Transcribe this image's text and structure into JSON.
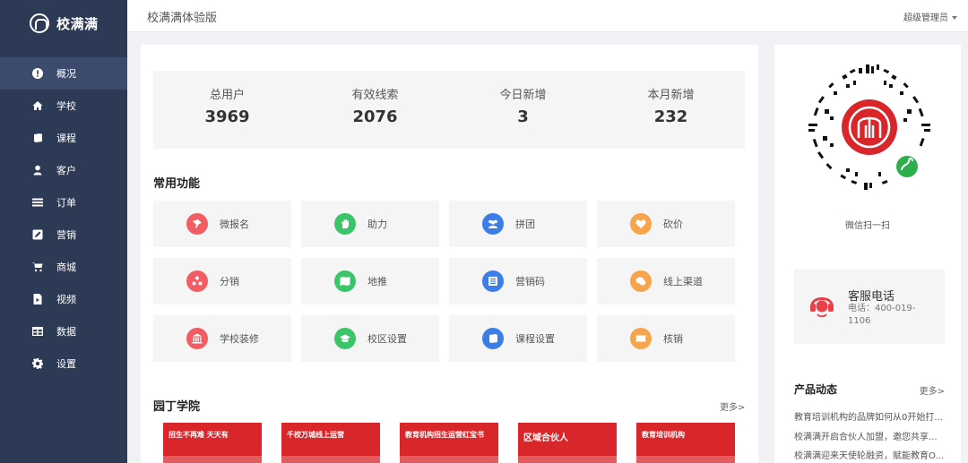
{
  "brand": {
    "name": "校满满"
  },
  "sidebar": {
    "items": [
      {
        "label": "概况",
        "icon": "alert-circle-icon",
        "active": true
      },
      {
        "label": "学校",
        "icon": "home-icon"
      },
      {
        "label": "课程",
        "icon": "book-icon"
      },
      {
        "label": "客户",
        "icon": "user-icon"
      },
      {
        "label": "订单",
        "icon": "list-icon"
      },
      {
        "label": "营销",
        "icon": "edit-icon"
      },
      {
        "label": "商城",
        "icon": "cart-icon"
      },
      {
        "label": "视频",
        "icon": "video-file-icon"
      },
      {
        "label": "数据",
        "icon": "table-icon"
      },
      {
        "label": "设置",
        "icon": "gear-icon"
      }
    ]
  },
  "header": {
    "title": "校满满体验版",
    "user": "超级管理员"
  },
  "stats": [
    {
      "label": "总用户",
      "value": "3969"
    },
    {
      "label": "有效线索",
      "value": "2076"
    },
    {
      "label": "今日新增",
      "value": "3"
    },
    {
      "label": "本月新增",
      "value": "232"
    }
  ],
  "functions": {
    "title": "常用功能",
    "items": [
      {
        "label": "微报名",
        "icon": "pin-icon",
        "color": "#f25c63"
      },
      {
        "label": "助力",
        "icon": "hand-icon",
        "color": "#3cc46a"
      },
      {
        "label": "拼团",
        "icon": "group-icon",
        "color": "#3d7de8"
      },
      {
        "label": "砍价",
        "icon": "heart-icon",
        "color": "#f6a54c"
      },
      {
        "label": "分销",
        "icon": "share-icon",
        "color": "#f25c63"
      },
      {
        "label": "地推",
        "icon": "map-icon",
        "color": "#3cc46a"
      },
      {
        "label": "营销码",
        "icon": "qrcode-icon",
        "color": "#3d7de8"
      },
      {
        "label": "线上渠道",
        "icon": "chat-icon",
        "color": "#f6a54c"
      },
      {
        "label": "学校装修",
        "icon": "building-icon",
        "color": "#f25c63"
      },
      {
        "label": "校区设置",
        "icon": "graduation-cap-icon",
        "color": "#3cc46a"
      },
      {
        "label": "课程设置",
        "icon": "book-icon",
        "color": "#3d7de8"
      },
      {
        "label": "核销",
        "icon": "ticket-icon",
        "color": "#f6a54c"
      }
    ]
  },
  "academy": {
    "title": "园丁学院",
    "more": "更多>",
    "banners": [
      {
        "text": "招生不再难 天天有",
        "color": "#d9262a"
      },
      {
        "text": "千校万城线上运营",
        "color": "#d9262a"
      },
      {
        "text": "教育机构招生运营红宝书",
        "color": "#c8202a"
      },
      {
        "text": "区域合伙人",
        "color": "#d9262a"
      },
      {
        "text": "教育培训机构",
        "color": "#d9262a"
      }
    ]
  },
  "right": {
    "qr_label": "微信扫一扫",
    "service_title": "客服电话",
    "service_phone": "电话：400-019-1106",
    "news_title": "产品动态",
    "news_more": "更多>",
    "news": [
      "教育培训机构的品牌如何从0开始打...",
      "校满满开启合伙人加盟，邀您共享...",
      "校满满迎来天使轮融资，赋能教育O..."
    ]
  }
}
